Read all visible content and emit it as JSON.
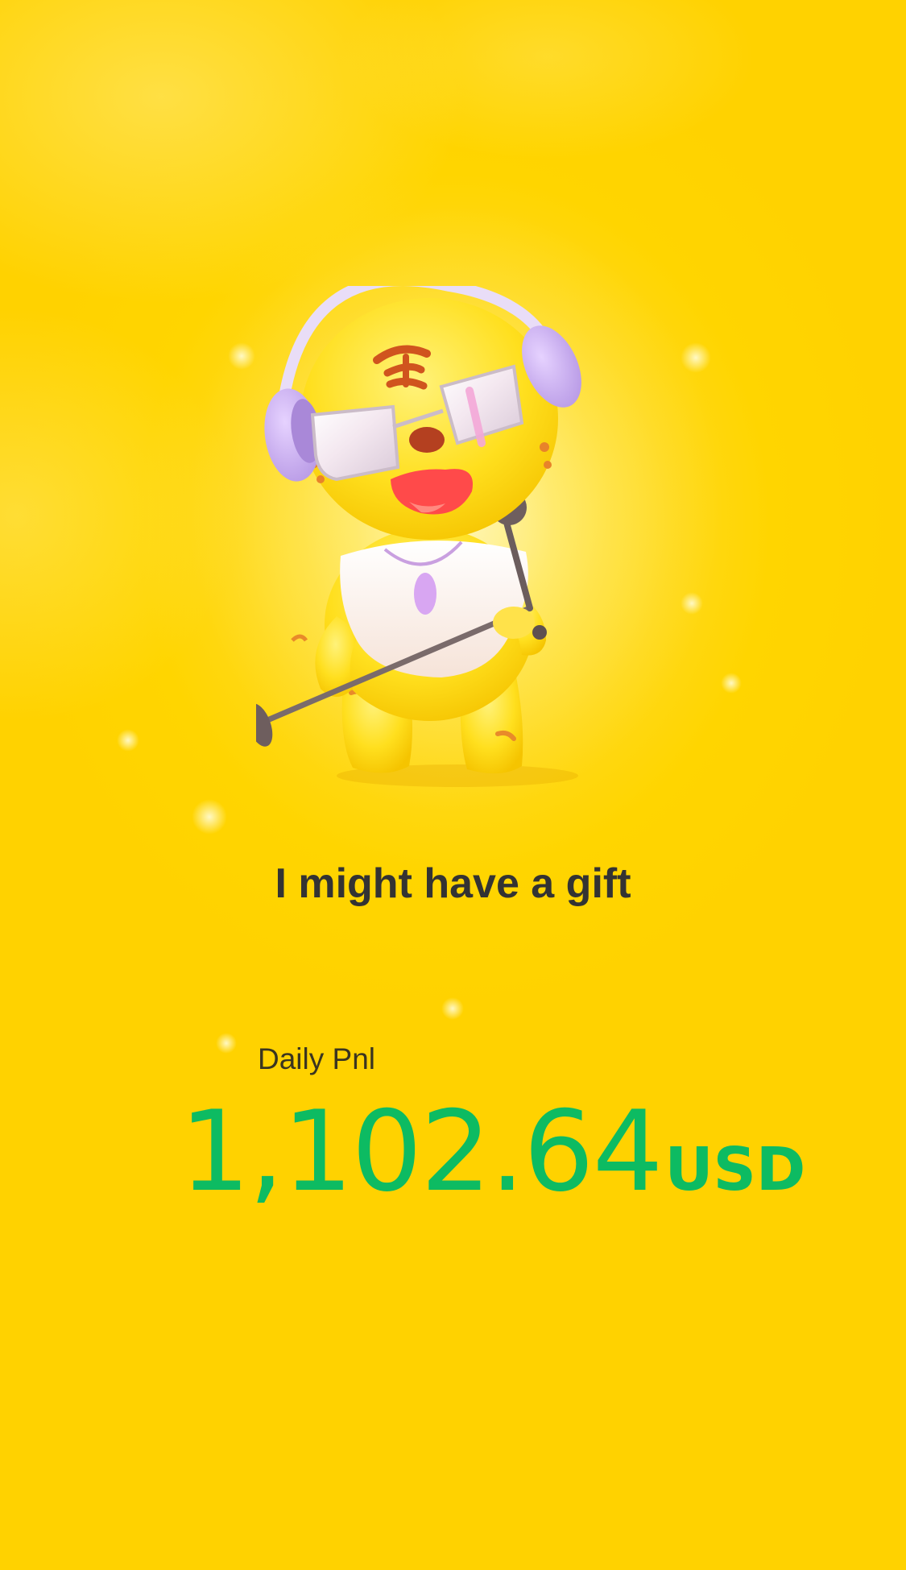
{
  "gift_message": "I might have a gift",
  "daily_pnl": {
    "label": "Daily Pnl",
    "value": "1,102.64",
    "unit": "USD"
  },
  "colors": {
    "background": "#ffd500",
    "title_text": "#333333",
    "pnl_value": "#0dbb62"
  },
  "icons": {
    "mascot": "tiger-singer-mascot-icon"
  }
}
